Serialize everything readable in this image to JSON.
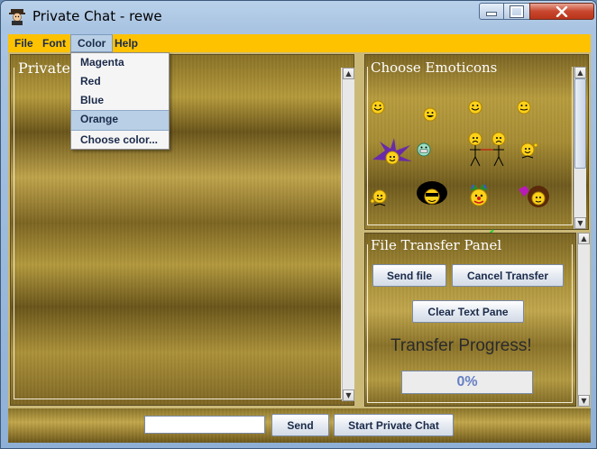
{
  "window": {
    "title": "Private Chat - rewe",
    "controls": [
      "minimize",
      "maximize",
      "close"
    ]
  },
  "menubar": {
    "items": [
      "File",
      "Font",
      "Color",
      "Help"
    ],
    "active": "Color",
    "color": "#ffc200"
  },
  "color_menu": {
    "items": [
      "Magenta",
      "Red",
      "Blue",
      "Orange",
      "Choose color..."
    ],
    "highlighted": "Orange"
  },
  "chat_panel": {
    "title": "Private Chat"
  },
  "emoticons_panel": {
    "title": "Choose Emoticons",
    "emoticons": [
      "smile-emoticon",
      "grin-emoticon",
      "smile-emoticon",
      "smile-emoticon",
      "jester-emoticon",
      "teeth-emoticon",
      "sad-couple-emoticon",
      "waving-emoticon",
      "waving-emoticon",
      "afro-emoticon",
      "clown-emoticon",
      "rocker-emoticon"
    ]
  },
  "file_transfer_panel": {
    "title": "File Transfer Panel",
    "send_file_label": "Send file",
    "cancel_transfer_label": "Cancel Transfer",
    "clear_text_label": "Clear Text Pane",
    "progress_label": "Transfer Progress!",
    "progress_text": "0%",
    "progress_value": 0
  },
  "bottom_bar": {
    "message_value": "",
    "send_label": "Send",
    "start_private_chat_label": "Start Private Chat"
  },
  "colors": {
    "menubar": "#ffc200",
    "highlight": "#b8cfe5",
    "close_button": "#c9472e"
  }
}
